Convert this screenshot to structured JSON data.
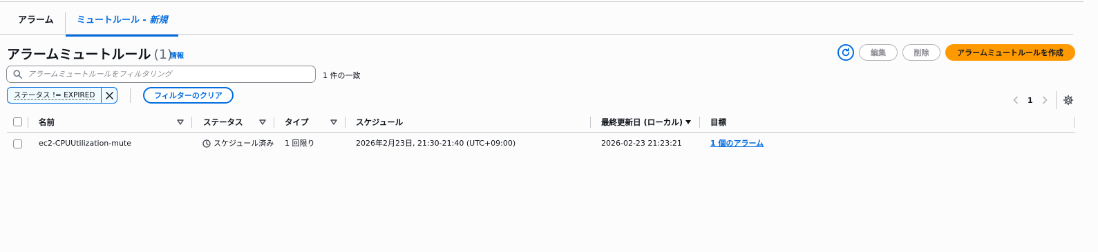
{
  "tabs": [
    {
      "label": "アラーム"
    },
    {
      "label": "ミュートルール",
      "suffix": "新規"
    }
  ],
  "page": {
    "title": "アラームミュートルール",
    "count": "(1)",
    "info": "情報"
  },
  "actions": {
    "edit": "編集",
    "delete": "削除",
    "create": "アラームミュートルールを作成"
  },
  "search": {
    "placeholder": "アラームミュートルールをフィルタリング",
    "value": ""
  },
  "match_count": "1 件の一致",
  "filter_token": "ステータス != EXPIRED",
  "clear_filters": "フィルターのクリア",
  "pagination": {
    "current": "1"
  },
  "table": {
    "headers": {
      "name": "名前",
      "status": "ステータス",
      "type": "タイプ",
      "schedule": "スケジュール",
      "updated": "最終更新日 (ローカル)",
      "targets": "目標"
    },
    "rows": [
      {
        "name": "ec2-CPUUtilization-mute",
        "status": "スケジュール済み",
        "type": "1 回限り",
        "schedule": "2026年2月23日, 21:30-21:40 (UTC+09:00)",
        "updated": "2026-02-23 21:23:21",
        "targets": "1 個のアラーム"
      }
    ]
  },
  "colors": {
    "accent": "#006ce0",
    "primary_button": "#ff9900",
    "disabled": "#8c8c94",
    "divider": "#c6c6cd"
  }
}
